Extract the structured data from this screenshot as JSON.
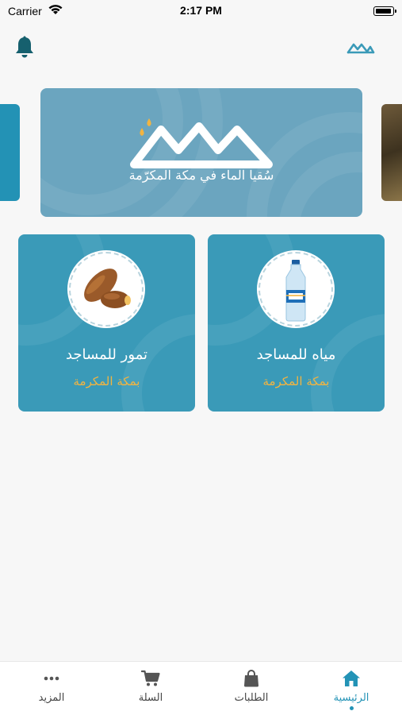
{
  "status_bar": {
    "carrier": "Carrier",
    "time": "2:17 PM"
  },
  "header": {
    "notification_icon": "bell-icon",
    "logo_icon": "brand-logo-icon"
  },
  "banner": {
    "slogan": "سُقيا الماء في مكة المكرّمة",
    "background_color": "#6ba5bf"
  },
  "products": [
    {
      "title": "مياه للمساجد",
      "subtitle": "بمكة المكرمة",
      "icon": "water-bottle-icon"
    },
    {
      "title": "تمور للمساجد",
      "subtitle": "بمكة المكرمة",
      "icon": "dates-icon"
    }
  ],
  "tabbar": {
    "items": [
      {
        "label": "الرئيسية",
        "icon": "home-icon",
        "active": true
      },
      {
        "label": "الطلبات",
        "icon": "shopping-bag-icon",
        "active": false
      },
      {
        "label": "السلة",
        "icon": "cart-icon",
        "active": false
      },
      {
        "label": "المزيد",
        "icon": "more-icon",
        "active": false
      }
    ]
  },
  "colors": {
    "primary": "#2393b6",
    "card": "#3a9ab8",
    "accent": "#f2b441",
    "background": "#f7f7f7"
  }
}
